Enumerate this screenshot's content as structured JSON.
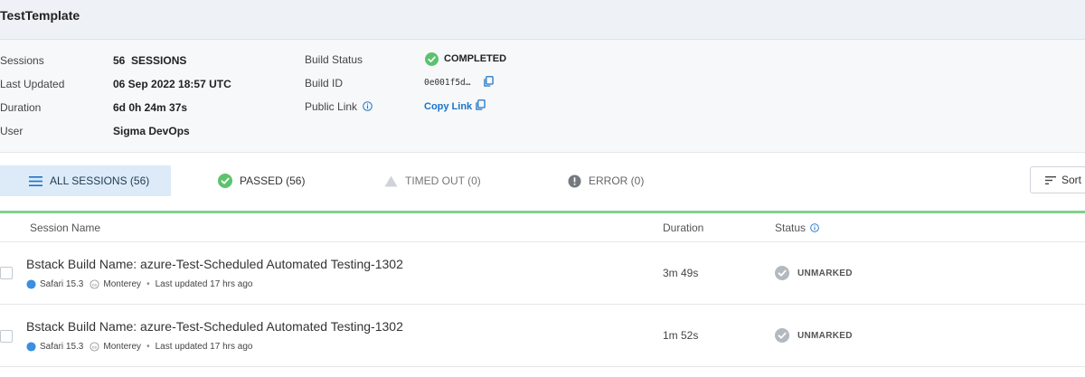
{
  "header": {
    "title": "TestTemplate"
  },
  "build_info": {
    "sessions_label": "Sessions",
    "sessions_count": "56",
    "sessions_unit": "SESSIONS",
    "last_updated_label": "Last Updated",
    "last_updated_value": "06 Sep 2022 18:57 UTC",
    "duration_label": "Duration",
    "duration_value": "6d 0h 24m 37s",
    "user_label": "User",
    "user_value": "Sigma DevOps",
    "build_status_label": "Build Status",
    "build_status_value": "COMPLETED",
    "build_id_label": "Build ID",
    "build_id_value": "0e001f5d…",
    "public_link_label": "Public Link",
    "copy_link_label": "Copy Link"
  },
  "filters": {
    "tabs": [
      {
        "label": "ALL SESSIONS (56)",
        "icon": "hamburger-icon",
        "active": true
      },
      {
        "label": "PASSED (56)",
        "icon": "check-circle-icon"
      },
      {
        "label": "TIMED OUT (0)",
        "icon": "warning-icon"
      },
      {
        "label": "ERROR (0)",
        "icon": "error-circle-icon"
      }
    ],
    "sort_label": "Sort"
  },
  "table": {
    "columns": {
      "name": "Session Name",
      "duration": "Duration",
      "status": "Status"
    },
    "rows": [
      {
        "name": "Bstack Build Name: azure-Test-Scheduled Automated Testing-1302",
        "browser": "Safari 15.3",
        "os": "Monterey",
        "updated": "Last updated 17 hrs ago",
        "duration": "3m 49s",
        "status": "UNMARKED"
      },
      {
        "name": "Bstack Build Name: azure-Test-Scheduled Automated Testing-1302",
        "browser": "Safari 15.3",
        "os": "Monterey",
        "updated": "Last updated 17 hrs ago",
        "duration": "1m 52s",
        "status": "UNMARKED"
      }
    ]
  },
  "colors": {
    "accent": "#1a73c9",
    "success": "#5cc26e",
    "progress": "#7fd18f",
    "active_tab_bg": "#dcebf7",
    "unmarked": "#b4b9bf"
  }
}
